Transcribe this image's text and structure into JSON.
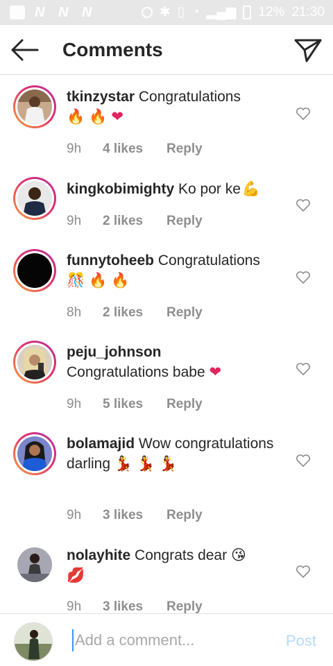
{
  "status_bar": {
    "carrier_icons": [
      "N",
      "N",
      "N"
    ],
    "battery": "12%",
    "time": "21:30"
  },
  "header": {
    "title": "Comments",
    "back_icon": "back-arrow-icon",
    "send_icon": "paper-plane-icon"
  },
  "comments": [
    {
      "username": "tkinzystar",
      "text": "Congratulations",
      "emojis": [
        "🔥",
        "🔥",
        "❤"
      ],
      "time": "9h",
      "likes": "4 likes",
      "reply": "Reply"
    },
    {
      "username": "kingkobimighty",
      "text": "Ko por ke",
      "emojis": [
        "💪"
      ],
      "time": "9h",
      "likes": "2 likes",
      "reply": "Reply"
    },
    {
      "username": "funnytoheeb",
      "text": "Congratulations",
      "emojis": [
        "🎊",
        "🔥",
        "🔥"
      ],
      "time": "8h",
      "likes": "2 likes",
      "reply": "Reply"
    },
    {
      "username": "peju_johnson",
      "text": "Congratulations babe",
      "emojis": [
        "❤"
      ],
      "time": "9h",
      "likes": "5 likes",
      "reply": "Reply"
    },
    {
      "username": "bolamajid",
      "text": "Wow congratulations darling",
      "emojis": [
        "💃",
        "💃",
        "💃"
      ],
      "time": "9h",
      "likes": "3 likes",
      "reply": "Reply"
    },
    {
      "username": "nolayhite",
      "text": "Congrats dear",
      "emojis": [
        "😘",
        "💋"
      ],
      "time": "9h",
      "likes": "3 likes",
      "reply": "Reply"
    }
  ],
  "composer": {
    "placeholder": "Add a comment...",
    "post_label": "Post"
  },
  "colors": {
    "link_disabled": "#b3dbff",
    "meta_gray": "#8e8e8e",
    "heart_red": "#e0245e",
    "story_ring": "#e1306c"
  }
}
